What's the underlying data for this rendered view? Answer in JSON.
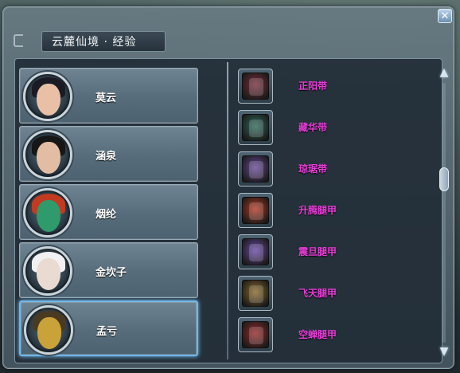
{
  "window": {
    "title": "云麓仙境 · 经验",
    "close_glyph": "✕"
  },
  "characters": [
    {
      "name": "莫云",
      "selected": false,
      "face_color": "#e9c0a6",
      "hair_color": "#1b1b26"
    },
    {
      "name": "涵泉",
      "selected": false,
      "face_color": "#e2bca3",
      "hair_color": "#161616"
    },
    {
      "name": "烟纶",
      "selected": false,
      "face_color": "#2f9a6b",
      "hair_color": "#c13a22"
    },
    {
      "name": "金坎子",
      "selected": false,
      "face_color": "#eadbd2",
      "hair_color": "#f1f1f4"
    },
    {
      "name": "孟亏",
      "selected": true,
      "face_color": "#caa23a",
      "hair_color": "#4a3a22"
    }
  ],
  "items": [
    {
      "name": "正阳带",
      "icon": "belt-icon",
      "color": "#7a2f3d"
    },
    {
      "name": "藏华带",
      "icon": "belt-icon",
      "color": "#2f6a5a"
    },
    {
      "name": "琼琚带",
      "icon": "belt-icon",
      "color": "#6a4a9a"
    },
    {
      "name": "升腾腿甲",
      "icon": "greaves-icon",
      "color": "#b43a22"
    },
    {
      "name": "震旦腿甲",
      "icon": "greaves-icon",
      "color": "#6a4aa8"
    },
    {
      "name": "飞天腿甲",
      "icon": "greaves-icon",
      "color": "#8a6a2a"
    },
    {
      "name": "空蝉腿甲",
      "icon": "greaves-icon",
      "color": "#9a2a2a"
    }
  ],
  "scroll": {
    "up_glyph": "▲",
    "down_glyph": "▼"
  },
  "colors": {
    "item_name": "#e63cd6",
    "selection_border": "#6fb6ea"
  }
}
